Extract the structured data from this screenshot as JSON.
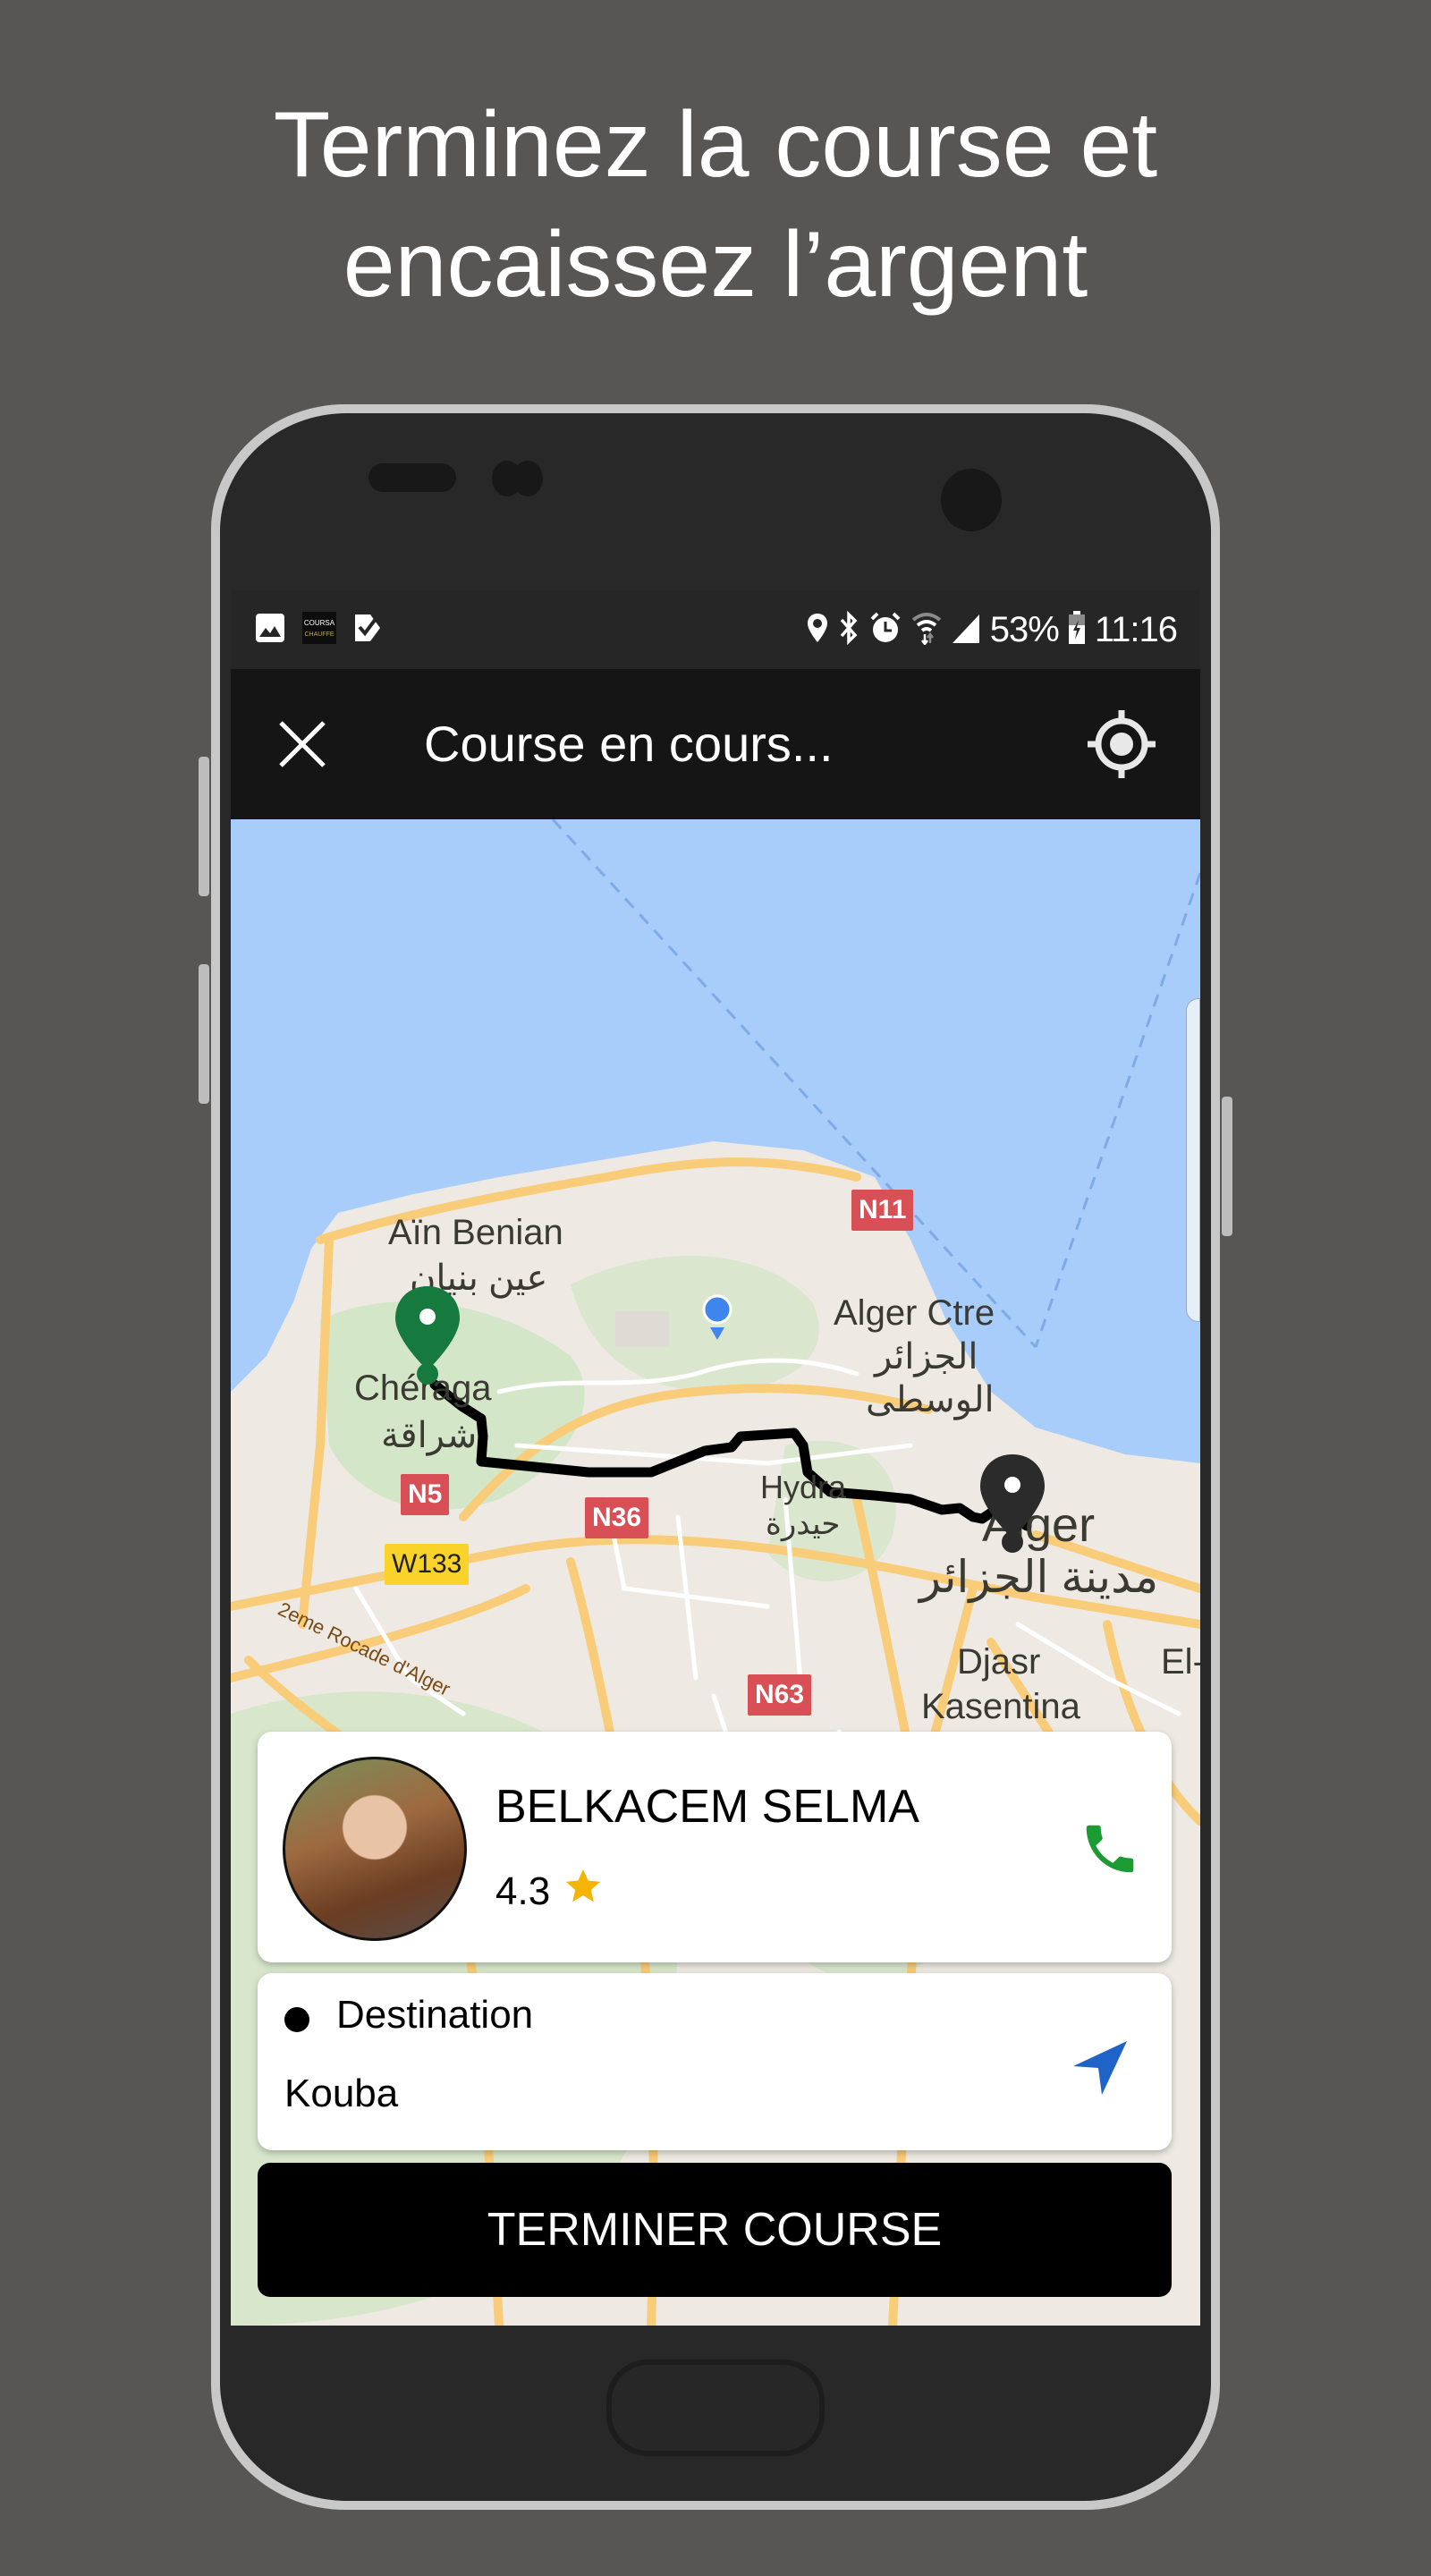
{
  "headline": {
    "line1": "Terminez la course et",
    "line2": "encaissez l’argent"
  },
  "status_bar": {
    "left_icons": [
      "image-icon",
      "coursa-app-icon",
      "task-check-icon"
    ],
    "right_icons": [
      "location-icon",
      "bluetooth-icon",
      "alarm-icon",
      "wifi-icon",
      "signal-icon"
    ],
    "battery_percent": "53%",
    "time": "11:16"
  },
  "toolbar": {
    "title": "Course en cours...",
    "close_icon": "close-icon",
    "locate_icon": "my-location-icon"
  },
  "map": {
    "labels": {
      "ain_benian": "Aïn Benian",
      "ain_benian_ar": "عين بنيان",
      "cheraga": "Chéraga",
      "cheraga_ar": "شراقة",
      "alger_ctre": "Alger Ctre",
      "alger_ctre_ar1": "الجزائر",
      "alger_ctre_ar2": "الوسطى",
      "hydra": "Hydra",
      "hydra_ar": "حيدرة",
      "alger": "Alger",
      "alger_ar": "مدينة الجزائر",
      "djasr": "Djasr",
      "kasentina": "Kasentina",
      "el": "El-",
      "rocade": "2eme Rocade d'Alger"
    },
    "route_badges": {
      "n11": "N11",
      "n5": "N5",
      "n36": "N36",
      "n63": "N63",
      "w133": "W133"
    },
    "colors": {
      "water": "#a8cdfb",
      "land": "#eeeae3",
      "park": "#d4e6c8",
      "road": "#f8cc78",
      "route": "#000000",
      "origin_marker": "#167a3e",
      "destination_marker": "#2b2b2b",
      "user_location": "#3f85ee"
    }
  },
  "passenger": {
    "name": "BELKACEM SELMA",
    "rating": "4.3",
    "rating_color": "#f4b400",
    "call_icon_color": "#1c9a34"
  },
  "destination": {
    "label": "Destination",
    "value": "Kouba",
    "nav_icon_color": "#1e63c8"
  },
  "actions": {
    "finish_label": "TERMINER COURSE"
  }
}
